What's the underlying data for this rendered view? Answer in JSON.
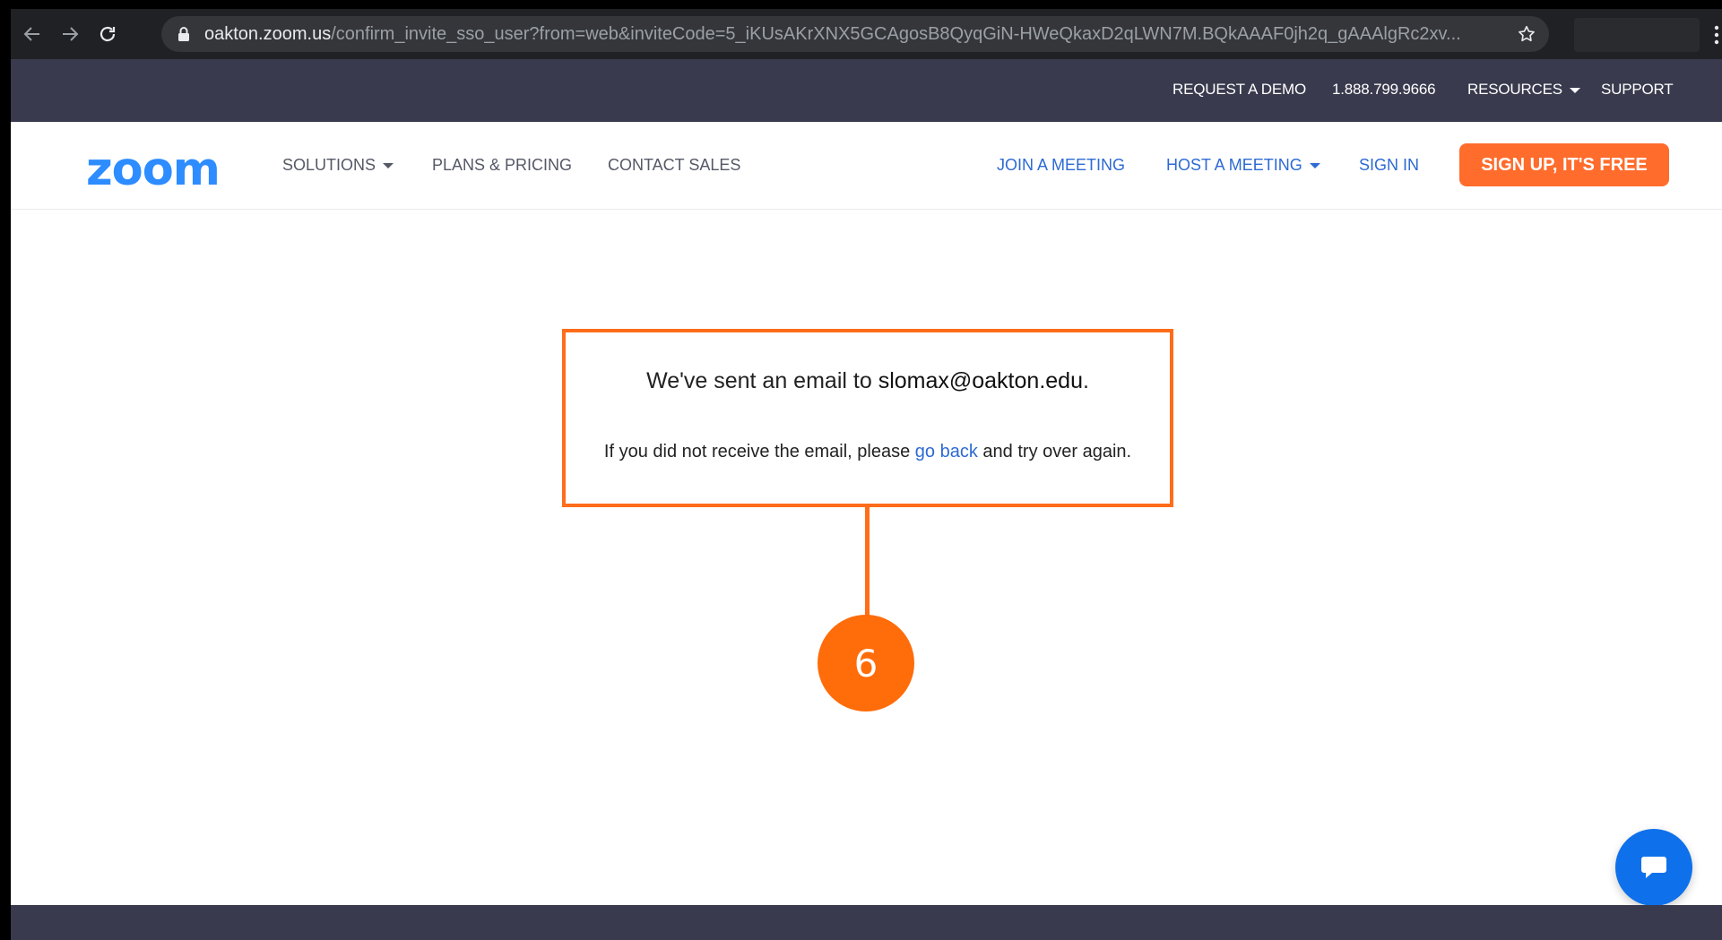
{
  "browser": {
    "url_host": "oakton.zoom.us",
    "url_path": "/confirm_invite_sso_user?from=web&inviteCode=5_iKUsAKrXNX5GCAgosB8QyqGiN-HWeQkaxD2qLWN7M.BQkAAAF0jh2q_gAAAlgRc2xv..."
  },
  "topbar": {
    "request_demo": "REQUEST A DEMO",
    "phone": "1.888.799.9666",
    "resources": "RESOURCES",
    "support": "SUPPORT"
  },
  "nav": {
    "logo": "zoom",
    "solutions": "SOLUTIONS",
    "plans_pricing": "PLANS & PRICING",
    "contact_sales": "CONTACT SALES",
    "join_meeting": "JOIN A MEETING",
    "host_meeting": "HOST A MEETING",
    "sign_in": "SIGN IN",
    "sign_up": "SIGN UP, IT'S FREE"
  },
  "message": {
    "sent_prefix": "We've sent an email to",
    "email": "slomax@oakton.edu",
    "sent_suffix": ".",
    "retry_prefix": "If you did not receive the email, please",
    "go_back": "go back",
    "retry_suffix": "and try over again."
  },
  "annotation": {
    "step": "6"
  },
  "colors": {
    "accent_orange": "#ff6c2c",
    "zoom_blue": "#2d8cff",
    "dark_bar": "#393a4d"
  }
}
